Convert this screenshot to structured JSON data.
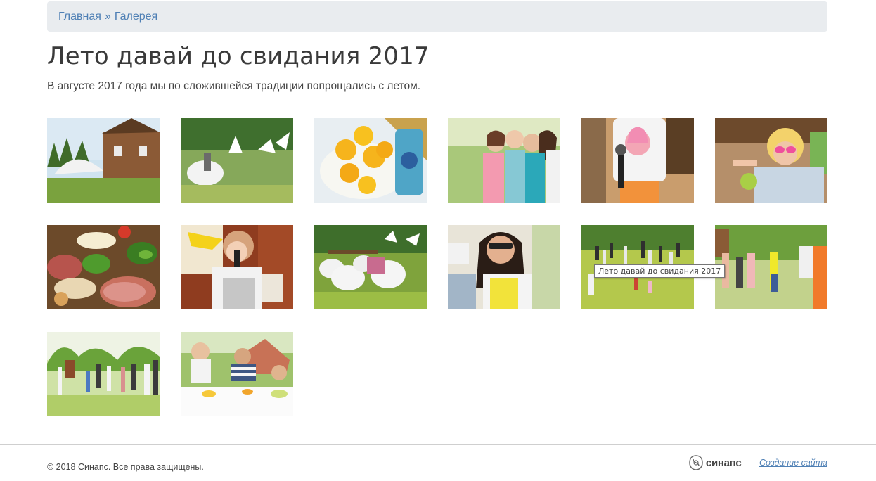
{
  "breadcrumb": {
    "home": "Главная",
    "separator": "»",
    "current": "Галерея"
  },
  "page": {
    "title": "Лето давай до свидания 2017",
    "description": "В августе 2017 года мы по сложившейся традиции попрощались с летом."
  },
  "gallery": {
    "tooltip": "Лето давай до свидания 2017",
    "thumbnails": [
      "house-tent-photo",
      "white-beanbags-photo",
      "lemons-bowl-photo",
      "girls-selfie-photo",
      "child-microphone-photo",
      "girl-sunglasses-photo",
      "food-platter-photo",
      "girl-singing-photo",
      "beanbags-group-photo",
      "woman-sunglasses-photo",
      "crowd-field-photo",
      "people-standing-photo",
      "people-park-photo",
      "children-table-photo"
    ]
  },
  "footer": {
    "copyright": "© 2018 Синапс. Все права защищены.",
    "brand": "синапс",
    "dash": "—",
    "link": "Создание сайта"
  },
  "colors": {
    "link": "#4f80b5",
    "breadcrumb_bg": "#e9ecef"
  }
}
